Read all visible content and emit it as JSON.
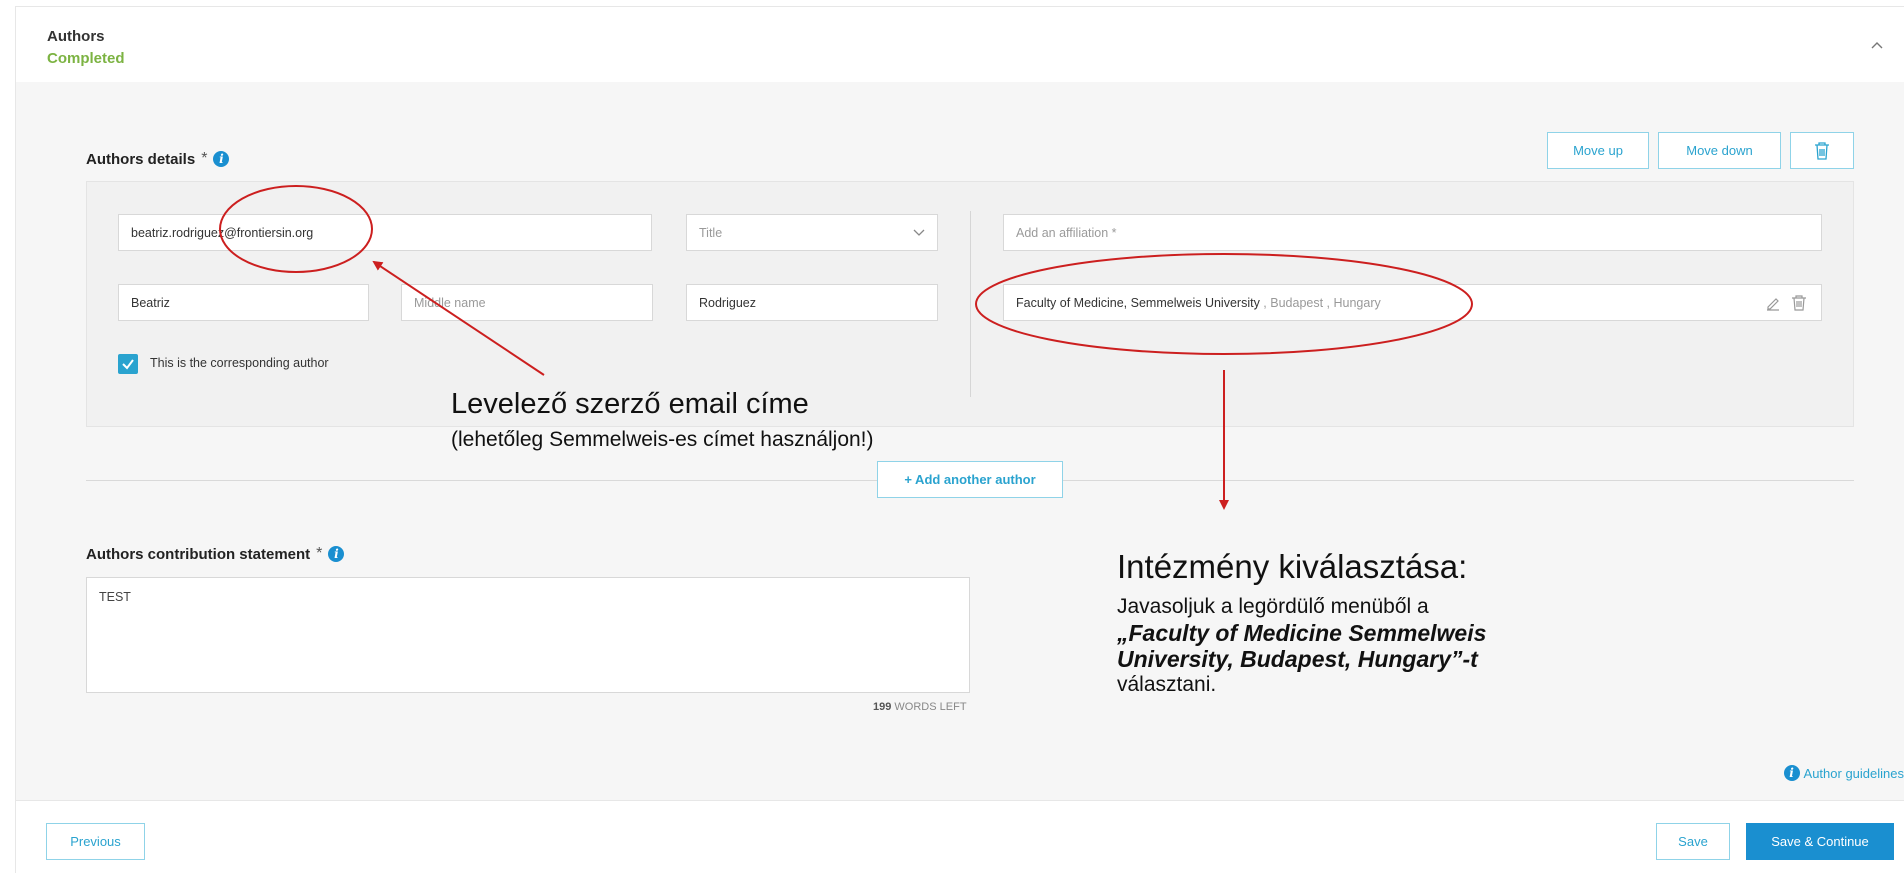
{
  "header": {
    "title": "Authors",
    "status": "Completed"
  },
  "authors_details": {
    "title": "Authors details",
    "required_mark": "*",
    "move_up": "Move up",
    "move_down": "Move down"
  },
  "author": {
    "email": "beatriz.rodriguez@frontiersin.org",
    "title_placeholder": "Title",
    "first_name": "Beatriz",
    "middle_name_placeholder": "Middle name",
    "last_name": "Rodriguez",
    "affiliation_placeholder": "Add an affiliation *",
    "affiliation_name": "Faculty of Medicine, Semmelweis University",
    "affiliation_location": " , Budapest , Hungary",
    "corresponding_label": "This is the corresponding author"
  },
  "add_author": "+ Add another author",
  "contribution": {
    "title": "Authors contribution statement",
    "required_mark": "*",
    "value": "TEST",
    "words_left_count": "199",
    "words_left_label": "WORDS LEFT"
  },
  "guidelines": "Author guidelines",
  "footer": {
    "previous": "Previous",
    "save": "Save",
    "save_continue": "Save & Continue"
  },
  "annotations": {
    "email_title": "Levelező szerző email címe",
    "email_sub": "(lehetőleg Semmelweis-es címet használjon!)",
    "inst_title": "Intézmény kiválasztása:",
    "inst_line1": "Javasoljuk a legördülő menüből a",
    "inst_bold1": "„Faculty of Medicine Semmelweis",
    "inst_bold2": "University, Budapest, Hungary”-t",
    "inst_line4": "választani."
  },
  "colors": {
    "accent": "#1a8fd0",
    "completed": "#7cb342",
    "annotation": "#cc1f1f"
  }
}
